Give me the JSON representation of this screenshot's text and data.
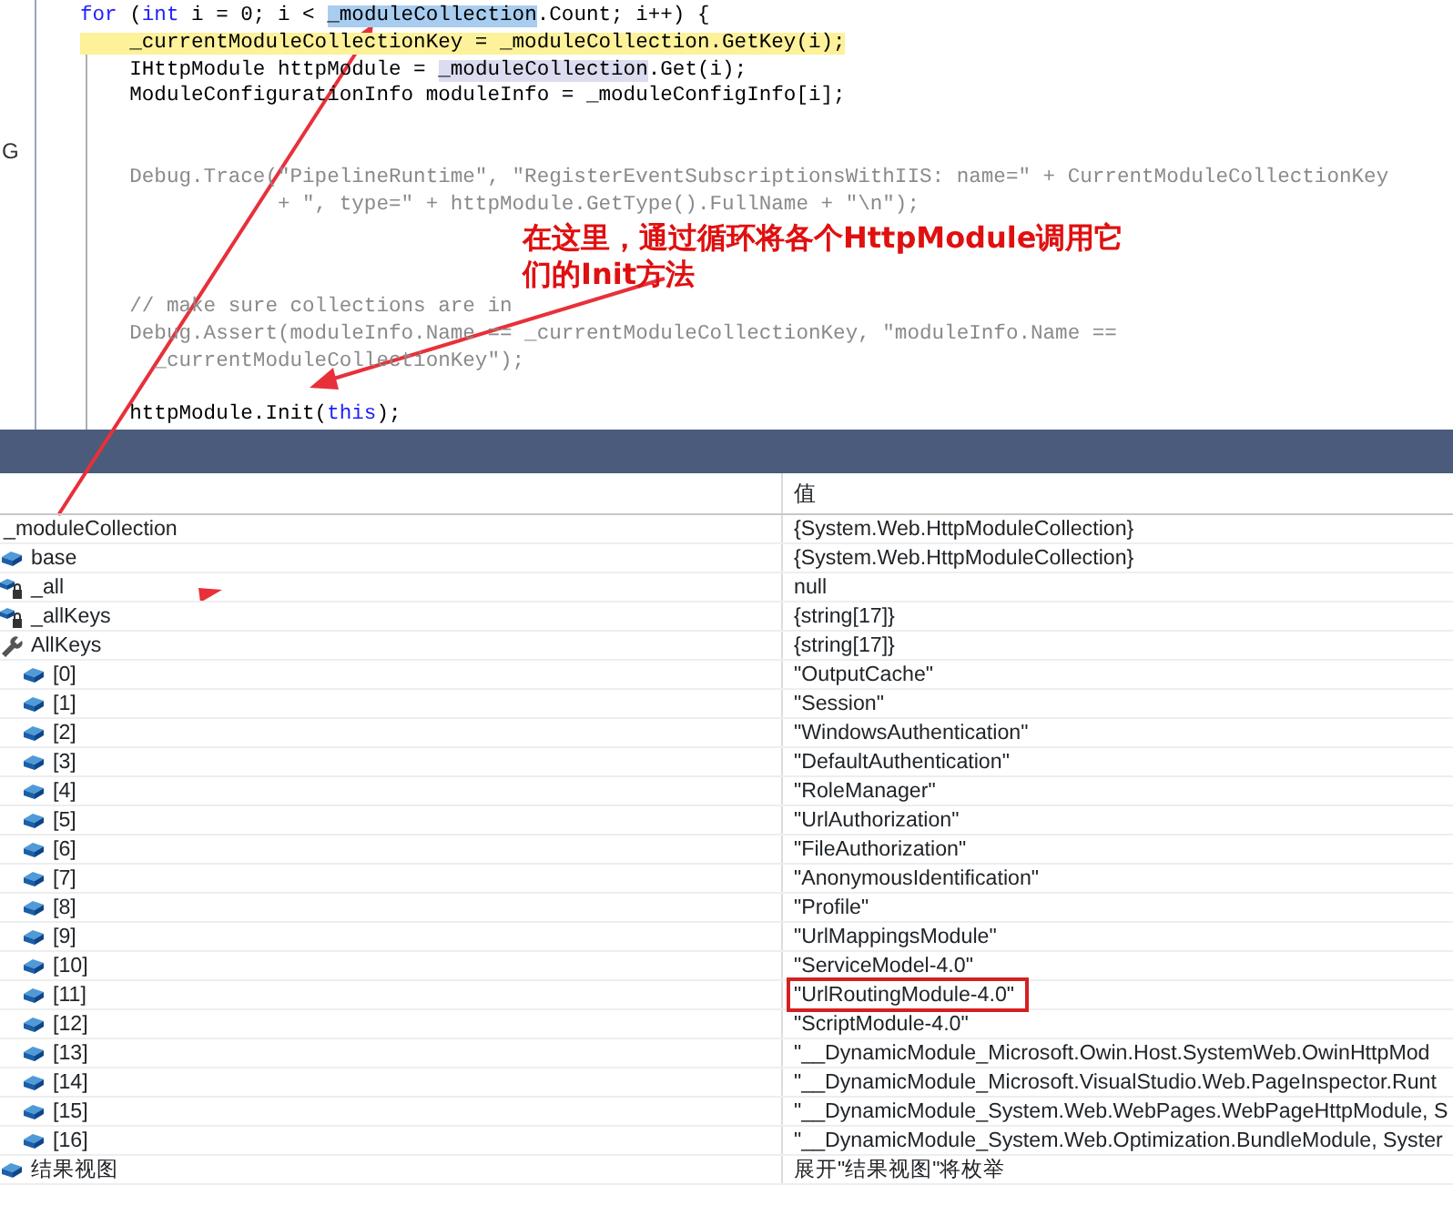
{
  "code_editor": {
    "lines": [
      {
        "current": false,
        "segments": [
          {
            "kind": "keyword",
            "text": "for"
          },
          {
            "kind": "plain",
            "text": " ("
          },
          {
            "kind": "keyword",
            "text": "int"
          },
          {
            "kind": "plain",
            "text": " i = 0; i < "
          },
          {
            "kind": "selected",
            "text": "_moduleCollection"
          },
          {
            "kind": "plain",
            "text": ".Count; i++) {"
          }
        ]
      },
      {
        "current": true,
        "segments": [
          {
            "kind": "plain",
            "text": "    _currentModuleCollectionKey = _moduleCollection.GetKey(i);"
          }
        ]
      },
      {
        "current": false,
        "segments": [
          {
            "kind": "plain",
            "text": "    IHttpModule httpModule = "
          },
          {
            "kind": "reference",
            "text": "_moduleCollection"
          },
          {
            "kind": "plain",
            "text": ".Get(i);"
          }
        ]
      },
      {
        "current": false,
        "segments": [
          {
            "kind": "plain",
            "text": "    ModuleConfigurationInfo moduleInfo = _moduleConfigInfo[i];"
          }
        ]
      },
      {
        "current": false
      },
      {
        "current": false,
        "gutter": "G"
      },
      {
        "current": false,
        "segments": [
          {
            "kind": "inactive",
            "text": "    Debug.Trace(\"PipelineRuntime\", \"RegisterEventSubscriptionsWithIIS: name=\" + CurrentModuleCollectionKey"
          }
        ]
      },
      {
        "current": false,
        "segments": [
          {
            "kind": "inactive",
            "text": "                + \", type=\" + httpModule.GetType().FullName + \"\\n\");"
          }
        ]
      },
      {
        "current": false
      },
      {
        "current": false,
        "segments": [
          {
            "kind": "inactive",
            "text": "    // make sure collections are in"
          }
        ]
      },
      {
        "current": false,
        "segments": [
          {
            "kind": "inactive",
            "text": "    Debug.Assert(moduleInfo.Name == _currentModuleCollectionKey, \"moduleInfo.Name == "
          }
        ]
      },
      {
        "current": false,
        "segments": [
          {
            "kind": "inactive",
            "text": "      _currentModuleCollectionKey\");"
          }
        ]
      },
      {
        "current": false
      },
      {
        "current": false,
        "segments": [
          {
            "kind": "plain",
            "text": "    httpModule.Init("
          },
          {
            "kind": "keyword",
            "text": "this"
          },
          {
            "kind": "plain",
            "text": ");"
          }
        ]
      }
    ]
  },
  "callout": {
    "text": "在这里，通过循环将各个**HttpModule**调用它们的**Init**方法"
  },
  "watch_panel": {
    "value_column_header": "值",
    "rows": [
      {
        "name": "_moduleCollection",
        "value": "{System.Web.HttpModuleCollection}",
        "boxed": false
      },
      {
        "kind": "field",
        "name": "base",
        "value": "{System.Web.HttpModuleCollection}",
        "boxed": false
      },
      {
        "kind": "private",
        "name": "_all",
        "value": "null",
        "boxed": false
      },
      {
        "kind": "private",
        "name": "_allKeys",
        "value": "{string[17]}",
        "boxed": false
      },
      {
        "kind": "property",
        "name": "AllKeys",
        "value": "{string[17]}",
        "boxed": false,
        "children": [
          {
            "kind": "field",
            "name": "[0]",
            "value": "\"OutputCache\"",
            "boxed": false
          },
          {
            "kind": "field",
            "name": "[1]",
            "value": "\"Session\"",
            "boxed": false
          },
          {
            "kind": "field",
            "name": "[2]",
            "value": "\"WindowsAuthentication\"",
            "boxed": false
          },
          {
            "kind": "field",
            "name": "[3]",
            "value": "\"DefaultAuthentication\"",
            "boxed": false
          },
          {
            "kind": "field",
            "name": "[4]",
            "value": "\"RoleManager\"",
            "boxed": false
          },
          {
            "kind": "field",
            "name": "[5]",
            "value": "\"UrlAuthorization\"",
            "boxed": false
          },
          {
            "kind": "field",
            "name": "[6]",
            "value": "\"FileAuthorization\"",
            "boxed": false
          },
          {
            "kind": "field",
            "name": "[7]",
            "value": "\"AnonymousIdentification\"",
            "boxed": false
          },
          {
            "kind": "field",
            "name": "[8]",
            "value": "\"Profile\"",
            "boxed": false
          },
          {
            "kind": "field",
            "name": "[9]",
            "value": "\"UrlMappingsModule\"",
            "boxed": false
          },
          {
            "kind": "field",
            "name": "[10]",
            "value": "\"ServiceModel-4.0\"",
            "boxed": false
          },
          {
            "kind": "field",
            "name": "[11]",
            "value": "\"UrlRoutingModule-4.0\"",
            "boxed": true
          },
          {
            "kind": "field",
            "name": "[12]",
            "value": "\"ScriptModule-4.0\"",
            "boxed": false
          },
          {
            "kind": "field",
            "name": "[13]",
            "value": "\"__DynamicModule_Microsoft.Owin.Host.SystemWeb.OwinHttpMod",
            "boxed": false
          },
          {
            "kind": "field",
            "name": "[14]",
            "value": "\"__DynamicModule_Microsoft.VisualStudio.Web.PageInspector.Runt",
            "boxed": false
          },
          {
            "kind": "field",
            "name": "[15]",
            "value": "\"__DynamicModule_System.Web.WebPages.WebPageHttpModule, S",
            "boxed": false
          },
          {
            "kind": "field",
            "name": "[16]",
            "value": "\"__DynamicModule_System.Web.Optimization.BundleModule, Syster",
            "boxed": false
          }
        ]
      },
      {
        "kind": "results",
        "name": "结果视图",
        "value": "展开\"结果视图\"将枚举",
        "boxed": false
      }
    ]
  }
}
